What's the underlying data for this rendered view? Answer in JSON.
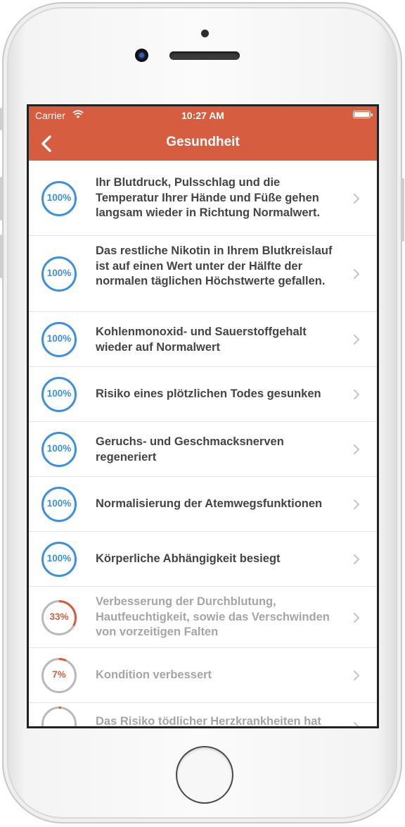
{
  "status_bar": {
    "carrier": "Carrier",
    "time": "10:27 AM"
  },
  "nav": {
    "title": "Gesundheit",
    "back_icon": "chevron-left-icon"
  },
  "colors": {
    "accent": "#d65d40",
    "ring_done": "#3d8fe0",
    "ring_progress": "#d65d40",
    "ring_track": "#b9b9b9",
    "text": "#444444",
    "text_dim": "#a5a5a5"
  },
  "items": [
    {
      "percent_label": "100%",
      "progress": 1.0,
      "text": "Ihr Blutdruck, Pulsschlag und die Temperatur Ihrer Hände und Füße gehen langsam wieder in Richtung Normalwert.",
      "done": true
    },
    {
      "percent_label": "100%",
      "progress": 1.0,
      "text": "Das restliche Nikotin in Ihrem Blutkreislauf ist auf einen Wert unter der Hälfte der normalen täglichen Höchstwerte gefallen.",
      "done": true
    },
    {
      "percent_label": "100%",
      "progress": 1.0,
      "text": "Kohlenmonoxid- und Sauerstoffgehalt wieder auf Normalwert",
      "done": true
    },
    {
      "percent_label": "100%",
      "progress": 1.0,
      "text": "Risiko eines plötzlichen Todes gesunken",
      "done": true
    },
    {
      "percent_label": "100%",
      "progress": 1.0,
      "text": "Geruchs- und Geschmacksnerven regeneriert",
      "done": true
    },
    {
      "percent_label": "100%",
      "progress": 1.0,
      "text": "Normalisierung der Atemwegsfunktionen",
      "done": true
    },
    {
      "percent_label": "100%",
      "progress": 1.0,
      "text": "Körperliche Abhängigkeit besiegt",
      "done": true
    },
    {
      "percent_label": "33%",
      "progress": 0.33,
      "text": "Verbesserung der Durchblutung, Hautfeuchtigkeit, sowie das Verschwinden von vorzeitigen Falten",
      "done": false
    },
    {
      "percent_label": "7%",
      "progress": 0.07,
      "text": "Kondition verbessert",
      "done": false
    },
    {
      "percent_label": "",
      "progress": 0.02,
      "text": "Das Risiko tödlicher Herzkrankheiten hat",
      "done": false
    }
  ]
}
